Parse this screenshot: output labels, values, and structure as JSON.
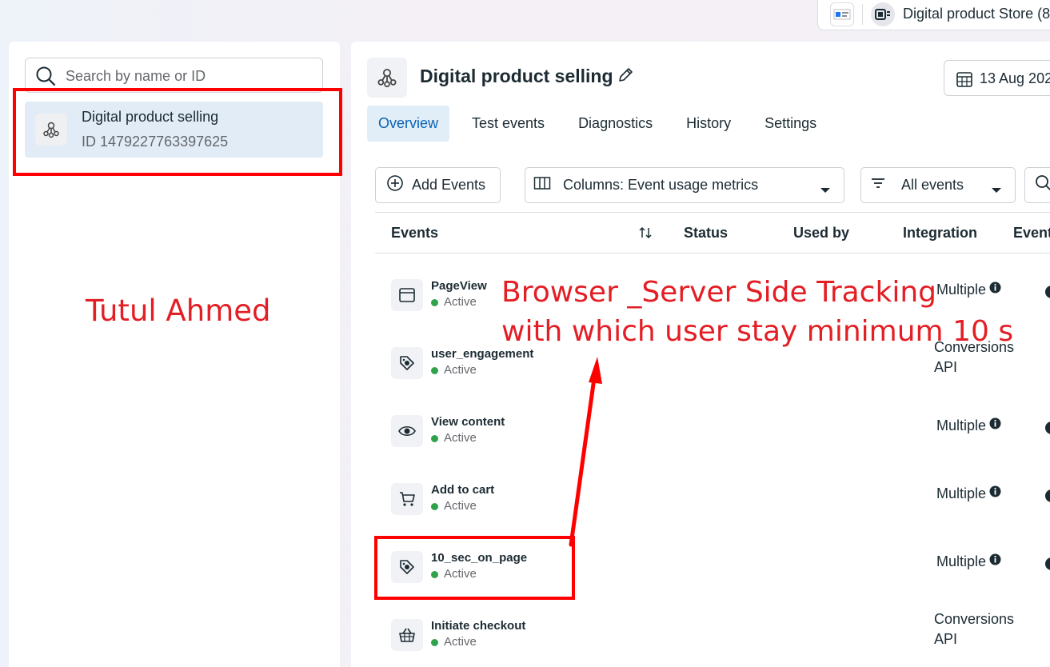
{
  "topbar": {
    "store_name": "Digital product Store (8"
  },
  "sidebar": {
    "search_placeholder": "Search by name or ID",
    "pixel": {
      "name": "Digital product selling",
      "id_text": "ID 1479227763397625"
    }
  },
  "annotations": {
    "watermark": "Tutul Ahmed",
    "note_line1": "Browser _Server Side Tracking",
    "note_line2": "with which user stay minimum 10 s",
    "colors": {
      "red": "#ff0000",
      "text_red": "#e31e24"
    }
  },
  "main": {
    "title": "Digital product selling",
    "date_label": "13 Aug 202",
    "tabs": [
      {
        "label": "Overview",
        "active": true
      },
      {
        "label": "Test events",
        "active": false
      },
      {
        "label": "Diagnostics",
        "active": false
      },
      {
        "label": "History",
        "active": false
      },
      {
        "label": "Settings",
        "active": false
      }
    ],
    "toolbar": {
      "add_events": "Add Events",
      "columns": "Columns: Event usage metrics",
      "filter": "All events"
    },
    "table": {
      "headers": {
        "events": "Events",
        "status": "Status",
        "used_by": "Used by",
        "integration": "Integration",
        "event": "Event"
      },
      "rows": [
        {
          "name": "PageView",
          "status": "Active",
          "integration": "Multiple",
          "icon": "browser-window-icon"
        },
        {
          "name": "user_engagement",
          "status": "Active",
          "integration_line1": "Conversions",
          "integration_line2": "API",
          "icon": "tag-icon"
        },
        {
          "name": "View content",
          "status": "Active",
          "integration": "Multiple",
          "icon": "eye-icon"
        },
        {
          "name": "Add to cart",
          "status": "Active",
          "integration": "Multiple",
          "icon": "cart-icon"
        },
        {
          "name": "10_sec_on_page",
          "status": "Active",
          "integration": "Multiple",
          "icon": "tag-icon"
        },
        {
          "name": "Initiate checkout",
          "status": "Active",
          "integration_line1": "Conversions",
          "integration_line2": "API",
          "icon": "basket-icon"
        }
      ]
    }
  }
}
